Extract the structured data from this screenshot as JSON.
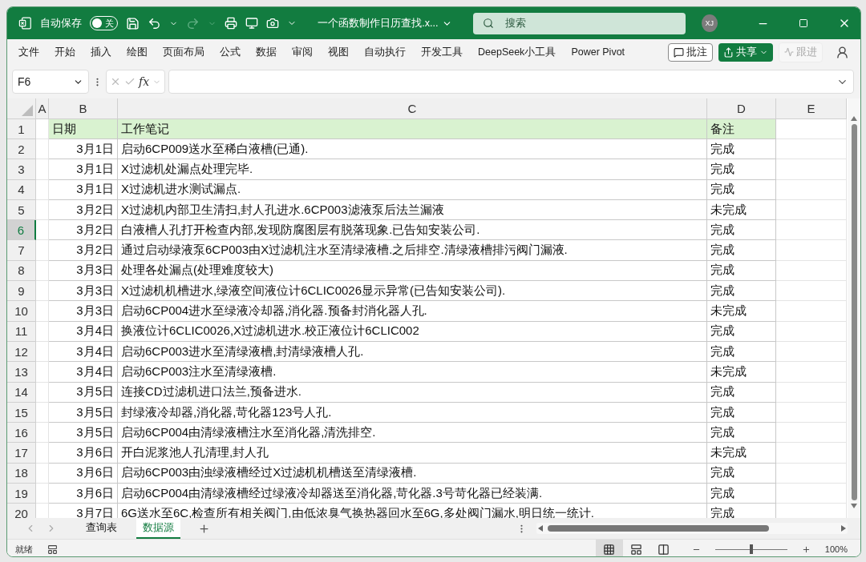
{
  "title_bar": {
    "autosave_label": "自动保存",
    "autosave": {
      "on": false,
      "label": "关"
    },
    "filename": "一个函数制作日历查找.x...",
    "search": {
      "placeholder": "搜索"
    },
    "avatar": "XJ"
  },
  "ribbon_tabs": [
    "文件",
    "开始",
    "插入",
    "绘图",
    "页面布局",
    "公式",
    "数据",
    "审阅",
    "视图",
    "自动执行",
    "开发工具",
    "DeepSeek小工具",
    "Power Pivot"
  ],
  "ribbon_buttons": {
    "comment": "批注",
    "share": "共享",
    "follow": {
      "label": "跟进",
      "disabled": true
    }
  },
  "formula_bar": {
    "name_box": "F6",
    "fx": "fx"
  },
  "columns": [
    "A",
    "B",
    "C",
    "D",
    "E"
  ],
  "header_row": {
    "number": "1",
    "cells": [
      "日期",
      "工作笔记",
      "备注"
    ]
  },
  "rows": [
    {
      "number": "2",
      "date": "3月1日",
      "note": "启动6CP009送水至稀白液槽(已通).",
      "remark": "完成",
      "selected": false
    },
    {
      "number": "3",
      "date": "3月1日",
      "note": "X过滤机处漏点处理完毕.",
      "remark": "完成",
      "selected": false
    },
    {
      "number": "4",
      "date": "3月1日",
      "note": "X过滤机进水测试漏点.",
      "remark": "完成",
      "selected": false
    },
    {
      "number": "5",
      "date": "3月2日",
      "note": "X过滤机内部卫生清扫,封人孔进水.6CP003滤液泵后法兰漏液",
      "remark": "未完成",
      "selected": false
    },
    {
      "number": "6",
      "date": "3月2日",
      "note": "白液槽人孔打开检查内部,发现防腐图层有脱落现象.已告知安装公司.",
      "remark": "完成",
      "selected": true
    },
    {
      "number": "7",
      "date": "3月2日",
      "note": "通过启动绿液泵6CP003由X过滤机注水至清绿液槽.之后排空.清绿液槽排污阀门漏液.",
      "remark": "完成",
      "selected": false
    },
    {
      "number": "8",
      "date": "3月3日",
      "note": "处理各处漏点(处理难度较大)",
      "remark": "完成",
      "selected": false
    },
    {
      "number": "9",
      "date": "3月3日",
      "note": "X过滤机机槽进水,绿液空间液位计6CLIC0026显示异常(已告知安装公司).",
      "remark": "完成",
      "selected": false
    },
    {
      "number": "10",
      "date": "3月3日",
      "note": "启动6CP004进水至绿液冷却器,消化器.预备封消化器人孔.",
      "remark": "未完成",
      "selected": false
    },
    {
      "number": "11",
      "date": "3月4日",
      "note": "换液位计6CLIC0026,X过滤机进水.校正液位计6CLIC002",
      "remark": "完成",
      "selected": false
    },
    {
      "number": "12",
      "date": "3月4日",
      "note": "启动6CP003进水至清绿液槽,封清绿液槽人孔.",
      "remark": "完成",
      "selected": false
    },
    {
      "number": "13",
      "date": "3月4日",
      "note": "启动6CP003注水至清绿液槽.",
      "remark": "未完成",
      "selected": false
    },
    {
      "number": "14",
      "date": "3月5日",
      "note": "连接CD过滤机进口法兰,预备进水.",
      "remark": "完成",
      "selected": false
    },
    {
      "number": "15",
      "date": "3月5日",
      "note": "封绿液冷却器,消化器,苛化器123号人孔.",
      "remark": "完成",
      "selected": false
    },
    {
      "number": "16",
      "date": "3月5日",
      "note": "启动6CP004由清绿液槽注水至消化器,清洗排空.",
      "remark": "完成",
      "selected": false
    },
    {
      "number": "17",
      "date": "3月6日",
      "note": "开白泥浆池人孔清理,封人孔",
      "remark": "未完成",
      "selected": false
    },
    {
      "number": "18",
      "date": "3月6日",
      "note": "启动6CP003由浊绿液槽经过X过滤机机槽送至清绿液槽.",
      "remark": "完成",
      "selected": false
    },
    {
      "number": "19",
      "date": "3月6日",
      "note": "启动6CP004由清绿液槽经过绿液冷却器送至消化器,苛化器.3号苛化器已经装满.",
      "remark": "完成",
      "selected": false
    },
    {
      "number": "20",
      "date": "3月7日",
      "note": "6G送水至6C,检查所有相关阀门,由低浓臭气换热器回水至6G,多处阀门漏水,明日统一统计.",
      "remark": "完成",
      "selected": false
    }
  ],
  "sheet_tabs": [
    {
      "label": "查询表",
      "selected": false
    },
    {
      "label": "数据源",
      "selected": true
    }
  ],
  "status_bar": {
    "status": "就绪",
    "views": [
      {
        "kind": "normal",
        "selected": true
      },
      {
        "kind": "page_layout",
        "selected": false
      },
      {
        "kind": "page_break",
        "selected": false
      }
    ],
    "zoom": {
      "level": 0.5,
      "label": "100%"
    }
  }
}
